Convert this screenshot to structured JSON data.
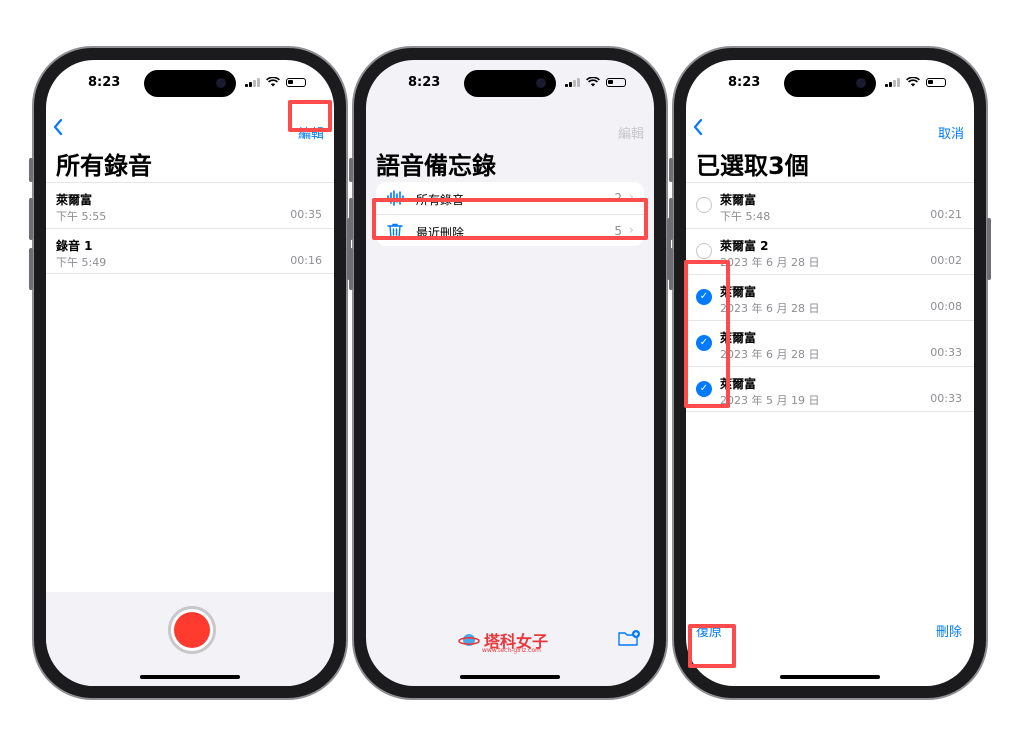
{
  "status": {
    "time": "8:23"
  },
  "screen1": {
    "title": "所有錄音",
    "edit_label": "編輯",
    "recordings": [
      {
        "name": "萊爾富",
        "date": "下午 5:55",
        "duration": "00:35"
      },
      {
        "name": "錄音 1",
        "date": "下午 5:49",
        "duration": "00:16"
      }
    ]
  },
  "screen2": {
    "title": "語音備忘錄",
    "edit_label": "編輯",
    "folders": [
      {
        "label": "所有錄音",
        "count": "2",
        "icon": "waveform-icon"
      },
      {
        "label": "最近刪除",
        "count": "5",
        "icon": "trash-icon"
      }
    ],
    "watermark": {
      "name": "塔科女子",
      "url": "www.tech-girlz.com"
    }
  },
  "screen3": {
    "title": "已選取3個",
    "cancel_label": "取消",
    "recover_label": "復原",
    "delete_label": "刪除",
    "recordings": [
      {
        "name": "萊爾富",
        "date": "下午 5:48",
        "duration": "00:21",
        "selected": false
      },
      {
        "name": "萊爾富 2",
        "date": "2023 年 6 月 28 日",
        "duration": "00:02",
        "selected": false
      },
      {
        "name": "萊爾富",
        "date": "2023 年 6 月 28 日",
        "duration": "00:08",
        "selected": true
      },
      {
        "name": "萊爾富",
        "date": "2023 年 6 月 28 日",
        "duration": "00:33",
        "selected": true
      },
      {
        "name": "萊爾富",
        "date": "2023 年 5 月 19 日",
        "duration": "00:33",
        "selected": true
      }
    ]
  },
  "colors": {
    "accent": "#007aff",
    "highlight": "#ff4b4b",
    "record": "#ff3b30"
  }
}
